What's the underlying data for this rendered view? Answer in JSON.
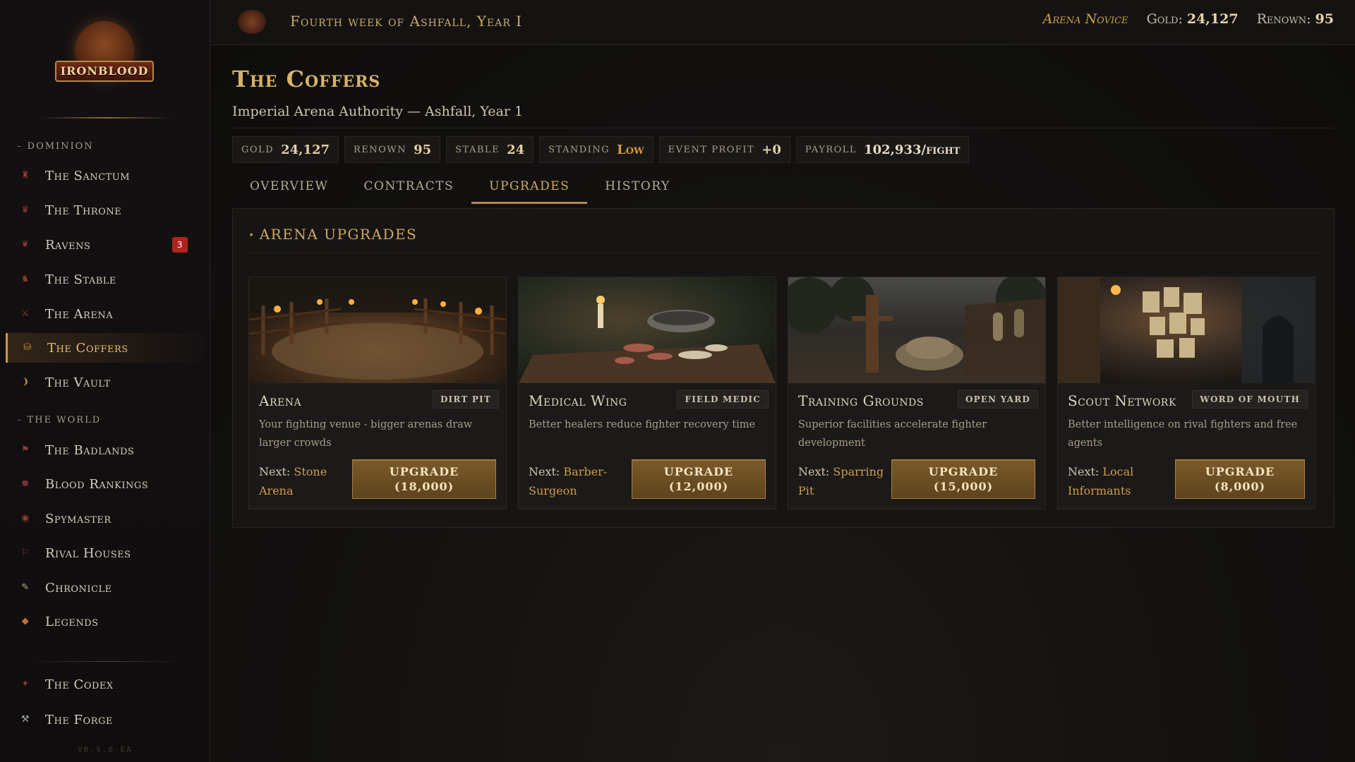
{
  "app": {
    "logo_text": "IRONBLOOD",
    "version": "V0.9.0-EA"
  },
  "sidebar": {
    "sections": [
      {
        "title": "Dominion"
      },
      {
        "title": "The World"
      }
    ],
    "items": [
      {
        "label": "The Sanctum",
        "icon": "sanctum-icon"
      },
      {
        "label": "The Throne",
        "icon": "throne-icon"
      },
      {
        "label": "Ravens",
        "icon": "raven-icon",
        "badge": "3"
      },
      {
        "label": "The Stable",
        "icon": "stable-icon"
      },
      {
        "label": "The Arena",
        "icon": "arena-icon"
      },
      {
        "label": "The Coffers",
        "icon": "coffers-icon",
        "active": true
      },
      {
        "label": "The Vault",
        "icon": "vault-icon"
      },
      {
        "label": "The Badlands",
        "icon": "badlands-icon"
      },
      {
        "label": "Blood Rankings",
        "icon": "rankings-icon"
      },
      {
        "label": "Spymaster",
        "icon": "spymaster-icon"
      },
      {
        "label": "Rival Houses",
        "icon": "rival-houses-icon"
      },
      {
        "label": "Chronicle",
        "icon": "chronicle-icon"
      },
      {
        "label": "Legends",
        "icon": "legends-icon"
      },
      {
        "label": "The Codex",
        "icon": "codex-icon"
      },
      {
        "label": "The Forge",
        "icon": "forge-icon"
      }
    ]
  },
  "topbar": {
    "date": "Fourth week of Ashfall, Year I",
    "rank": "Arena Novice",
    "gold_label": "Gold:",
    "gold_value": "24,127",
    "renown_label": "Renown:",
    "renown_value": "95"
  },
  "page": {
    "title": "The Coffers",
    "subtitle": "Imperial Arena Authority — Ashfall, Year 1",
    "stats": [
      {
        "label": "Gold",
        "value": "24,127"
      },
      {
        "label": "Renown",
        "value": "95"
      },
      {
        "label": "Stable",
        "value": "24"
      },
      {
        "label": "Standing",
        "value": "Low"
      },
      {
        "label": "Event Profit",
        "value": "+0"
      },
      {
        "label": "Payroll",
        "value": "102,933/fight"
      }
    ],
    "tabs": [
      {
        "label": "Overview"
      },
      {
        "label": "Contracts"
      },
      {
        "label": "Upgrades",
        "active": true
      },
      {
        "label": "History"
      }
    ]
  },
  "upgrades": {
    "heading": "Arena Upgrades",
    "cards": [
      {
        "name": "Arena",
        "tier": "Dirt Pit",
        "desc": "Your fighting venue - bigger arenas draw larger crowds",
        "next_label": "Next:",
        "next_value": "Stone Arena",
        "button_label": "Upgrade",
        "cost": "(18,000)"
      },
      {
        "name": "Medical Wing",
        "tier": "Field Medic",
        "desc": "Better healers reduce fighter recovery time",
        "next_label": "Next:",
        "next_value": "Barber-Surgeon",
        "button_label": "Upgrade",
        "cost": "(12,000)"
      },
      {
        "name": "Training Grounds",
        "tier": "Open Yard",
        "desc": "Superior facilities accelerate fighter development",
        "next_label": "Next:",
        "next_value": "Sparring Pit",
        "button_label": "Upgrade",
        "cost": "(15,000)"
      },
      {
        "name": "Scout Network",
        "tier": "Word of Mouth",
        "desc": "Better intelligence on rival fighters and free agents",
        "next_label": "Next:",
        "next_value": "Local Informants",
        "button_label": "Upgrade",
        "cost": "(8,000)"
      }
    ]
  },
  "colors": {
    "accent_gold": "#d6b36a",
    "button_bg": "#6a4d22",
    "badge_red": "#b0231d",
    "standing_low": "#d19a3a"
  }
}
